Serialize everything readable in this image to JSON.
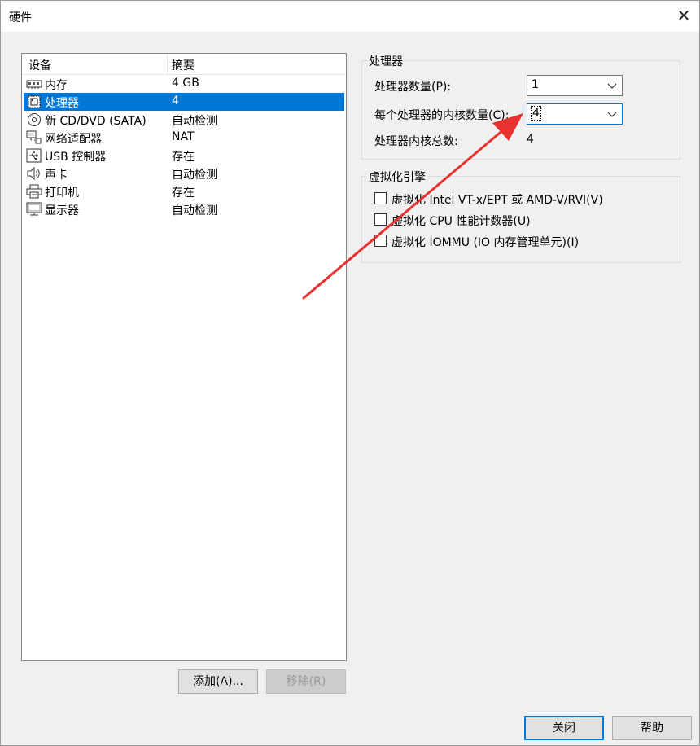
{
  "window": {
    "title": "硬件"
  },
  "device_list": {
    "headers": [
      "设备",
      "摘要"
    ],
    "rows": [
      {
        "icon": "memory-icon",
        "name": "内存",
        "summary": "4 GB",
        "selected": false
      },
      {
        "icon": "processor-icon",
        "name": "处理器",
        "summary": "4",
        "selected": true
      },
      {
        "icon": "cd-dvd-icon",
        "name": "新 CD/DVD (SATA)",
        "summary": "自动检测",
        "selected": false
      },
      {
        "icon": "network-adapter-icon",
        "name": "网络适配器",
        "summary": "NAT",
        "selected": false
      },
      {
        "icon": "usb-icon",
        "name": "USB 控制器",
        "summary": "存在",
        "selected": false
      },
      {
        "icon": "speaker-icon",
        "name": "声卡",
        "summary": "自动检测",
        "selected": false
      },
      {
        "icon": "printer-icon",
        "name": "打印机",
        "summary": "存在",
        "selected": false
      },
      {
        "icon": "monitor-icon",
        "name": "显示器",
        "summary": "自动检测",
        "selected": false
      }
    ],
    "add_button": "添加(A)...",
    "remove_button": "移除(R)"
  },
  "processor_group": {
    "title": "处理器",
    "count_label": "处理器数量(P):",
    "count_value": "1",
    "cores_label": "每个处理器的内核数量(C):",
    "cores_value": "4",
    "total_label": "处理器内核总数:",
    "total_value": "4"
  },
  "virtualization_group": {
    "title": "虚拟化引擎",
    "options": [
      {
        "label": "虚拟化 Intel VT-x/EPT 或 AMD-V/RVI(V)",
        "checked": false
      },
      {
        "label": "虚拟化 CPU 性能计数器(U)",
        "checked": false
      },
      {
        "label": "虚拟化 IOMMU (IO 内存管理单元)(I)",
        "checked": false
      }
    ]
  },
  "footer": {
    "close_button": "关闭",
    "help_button": "帮助"
  },
  "colors": {
    "selection": "#0078d7",
    "annotation_arrow": "#e8322f",
    "window_bg": "#f0f0f0"
  }
}
